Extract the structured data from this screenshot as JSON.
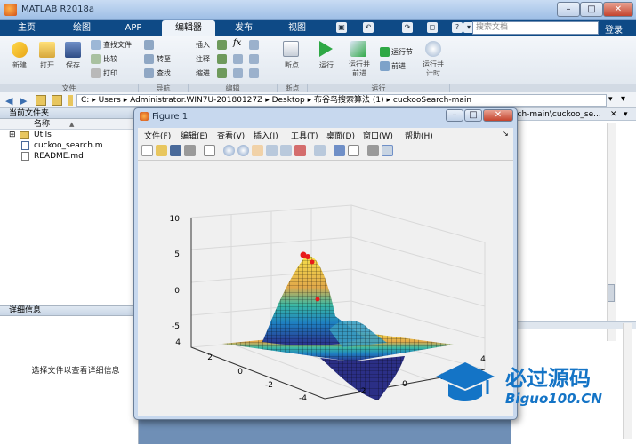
{
  "window": {
    "title": "MATLAB R2018a",
    "controls": [
      "–",
      "□",
      "✕"
    ]
  },
  "tabs": [
    "主页",
    "绘图",
    "APP",
    "编辑器",
    "发布",
    "视图"
  ],
  "active_tab": "编辑器",
  "quick_access": [
    "▣",
    "↶",
    "↷",
    "◻",
    "?",
    "▾"
  ],
  "search": {
    "placeholder": "搜索文档"
  },
  "login": "登录",
  "ribbon": {
    "file": {
      "label": "文件",
      "new": "新建",
      "open": "打开",
      "save": "保存",
      "find_files": "查找文件",
      "compare": "比较",
      "print": "打印"
    },
    "navigate": {
      "label": "导航",
      "goto": "转至",
      "find": "查找"
    },
    "edit": {
      "label": "编辑",
      "insert": "插入",
      "comment": "注释",
      "indent": "缩进",
      "fx": "fx"
    },
    "breakpoints": {
      "label": "断点",
      "breakpoint": "断点"
    },
    "run": {
      "label": "运行",
      "run": "运行",
      "run_advance": "运行并\n前进",
      "run_section": "运行节",
      "advance": "前进",
      "run_time": "运行并\n计时"
    }
  },
  "address": {
    "path": [
      "C:",
      "Users",
      "Administrator.WIN7U-20180127Z",
      "Desktop",
      "布谷鸟搜索算法 (1)",
      "cuckooSearch-main"
    ],
    "separator": "▸"
  },
  "current_folder": {
    "title": "当前文件夹",
    "column": "名称",
    "sort": "▲",
    "items": [
      {
        "name": "Utils",
        "type": "folder"
      },
      {
        "name": "cuckoo_search.m",
        "type": "m-file"
      },
      {
        "name": "README.md",
        "type": "doc"
      }
    ]
  },
  "details": {
    "title": "详细信息",
    "empty_text": "选择文件以查看详细信息"
  },
  "editor_tab_text": "rch-main\\cuckoo_se...",
  "figure": {
    "title": "Figure 1",
    "menu": [
      "文件(F)",
      "编辑(E)",
      "查看(V)",
      "插入(I)",
      "工具(T)",
      "桌面(D)",
      "窗口(W)",
      "帮助(H)"
    ],
    "z_ticks": [
      "10",
      "5",
      "0",
      "-5"
    ],
    "y_ticks": [
      "4",
      "2",
      "0",
      "-2",
      "-4"
    ],
    "x_ticks": [
      "-2",
      "0",
      "2",
      "4"
    ]
  },
  "watermark": {
    "line1": "必过源码",
    "line2": "Biguo100.CN"
  },
  "colors": {
    "title_bar": "#b7cfee",
    "tab_bar": "#0e4a86",
    "surface_high": "#e8c84a",
    "surface_low": "#2a2f8a",
    "marker": "#e81b1b",
    "watermark": "#1474c6"
  }
}
